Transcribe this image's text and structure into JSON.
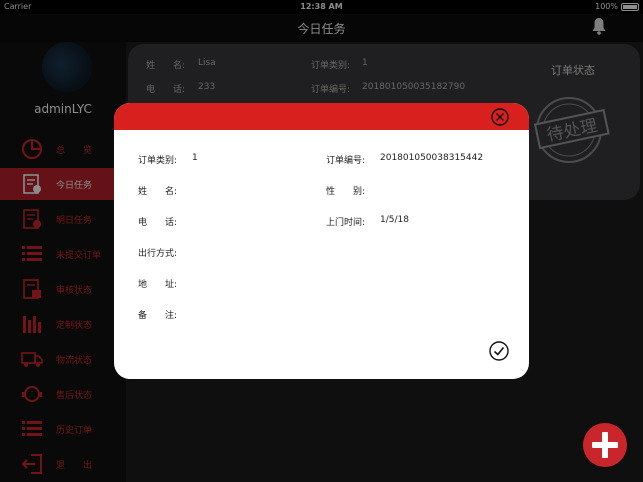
{
  "status_bar": {
    "carrier": "Carrier",
    "time": "12:38 AM",
    "battery": "100%"
  },
  "nav": {
    "title": "今日任务"
  },
  "sidebar": {
    "username": "adminLYC",
    "items": [
      {
        "label": "总　　览",
        "icon": "pie-chart-icon"
      },
      {
        "label": "今日任务",
        "icon": "today-tasks-icon",
        "active": true
      },
      {
        "label": "明日任务",
        "icon": "tomorrow-tasks-icon"
      },
      {
        "label": "未提交订单",
        "icon": "list-icon"
      },
      {
        "label": "审核状态",
        "icon": "review-icon"
      },
      {
        "label": "定制状态",
        "icon": "bars-icon"
      },
      {
        "label": "物流状态",
        "icon": "truck-icon"
      },
      {
        "label": "售后状态",
        "icon": "after-sale-icon"
      },
      {
        "label": "历史订单",
        "icon": "history-icon"
      },
      {
        "label": "退　　出",
        "icon": "logout-icon"
      }
    ]
  },
  "background_card": {
    "name_label": "姓　　名:",
    "name_value": "Lisa",
    "phone_label": "电　　话:",
    "phone_value": "233",
    "type_label": "订单类别:",
    "type_value": "1",
    "number_label": "订单编号:",
    "number_value": "201801050035182790",
    "status_title": "订单状态",
    "stamp_text": "待处理"
  },
  "modal": {
    "fields": {
      "order_type_label": "订单类别:",
      "order_type_value": "1",
      "order_number_label": "订单编号:",
      "order_number_value": "201801050038315442",
      "name_label": "姓　　名:",
      "name_value": "",
      "gender_label": "性　　别:",
      "gender_value": "",
      "phone_label": "电　　话:",
      "phone_value": "",
      "visit_time_label": "上门时间:",
      "visit_time_value": "1/5/18",
      "travel_label": "出行方式:",
      "travel_value": "",
      "address_label": "地　　址:",
      "address_value": "",
      "remark_label": "备　　注:",
      "remark_value": ""
    }
  },
  "colors": {
    "accent": "#d8201e",
    "sidebar_bg": "#111111",
    "card_bg": "#3a3a3d"
  }
}
